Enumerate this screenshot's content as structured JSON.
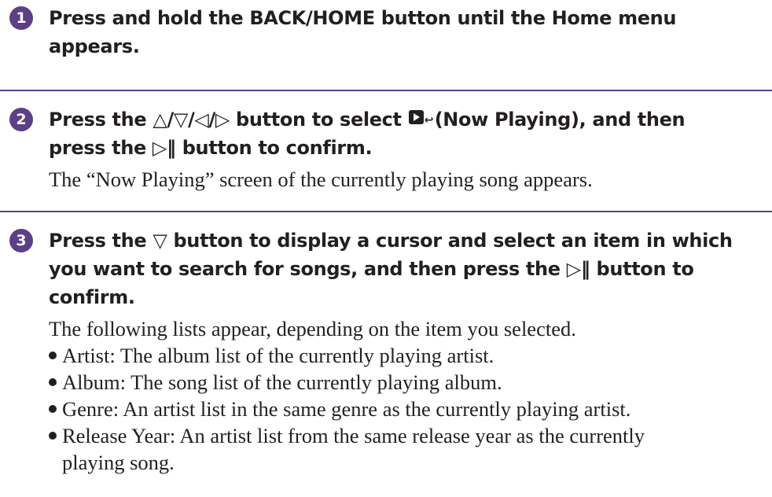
{
  "steps": [
    {
      "number": "1",
      "heading_line1": "Press and hold the BACK/HOME button until the Home menu",
      "heading_line2": "appears."
    },
    {
      "number": "2",
      "heading_a": "Press the",
      "heading_arrows": "△/▽/◁/▷",
      "heading_b": "button to select",
      "icon_name": "now-playing-icon",
      "heading_c": "(Now Playing), and then",
      "heading_line2_a": "press the",
      "play_pause_glyph": "▷‖",
      "heading_line2_b": "button to confirm.",
      "body": "The “Now Playing” screen of the currently playing song appears."
    },
    {
      "number": "3",
      "heading_a": "Press the",
      "down_glyph": "▽",
      "heading_b": "button to display a cursor and select an item in which",
      "heading_line2_a": "you want to search for songs, and then press the",
      "play_pause_glyph": "▷‖",
      "heading_line2_b": "button to",
      "heading_line3": "confirm.",
      "body": "The following lists appear, depending on the item you selected.",
      "bullets": [
        "Artist: The album list of the currently playing artist.",
        "Album: The song list of the currently playing album.",
        "Genre: An artist list in the same genre as the currently playing artist.",
        "Release Year: An artist list from the same release year as the currently"
      ],
      "bullet_continuation": "playing song."
    }
  ],
  "colors": {
    "accent": "#5c3f86",
    "text": "#231f20"
  }
}
